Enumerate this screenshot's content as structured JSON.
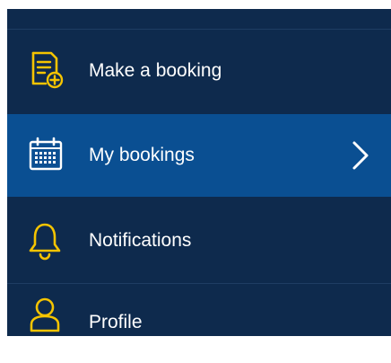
{
  "colors": {
    "panel_background": "#0e2a4d",
    "active_background": "#0a4f92",
    "icon_accent": "#f5c400",
    "text": "#ffffff"
  },
  "menu": {
    "items": [
      {
        "label": "Make a booking",
        "icon": "document-add-icon",
        "active": false
      },
      {
        "label": "My bookings",
        "icon": "calendar-icon",
        "active": true,
        "has_chevron": true
      },
      {
        "label": "Notifications",
        "icon": "bell-icon",
        "active": false
      },
      {
        "label": "Profile",
        "icon": "user-icon",
        "active": false
      }
    ]
  }
}
